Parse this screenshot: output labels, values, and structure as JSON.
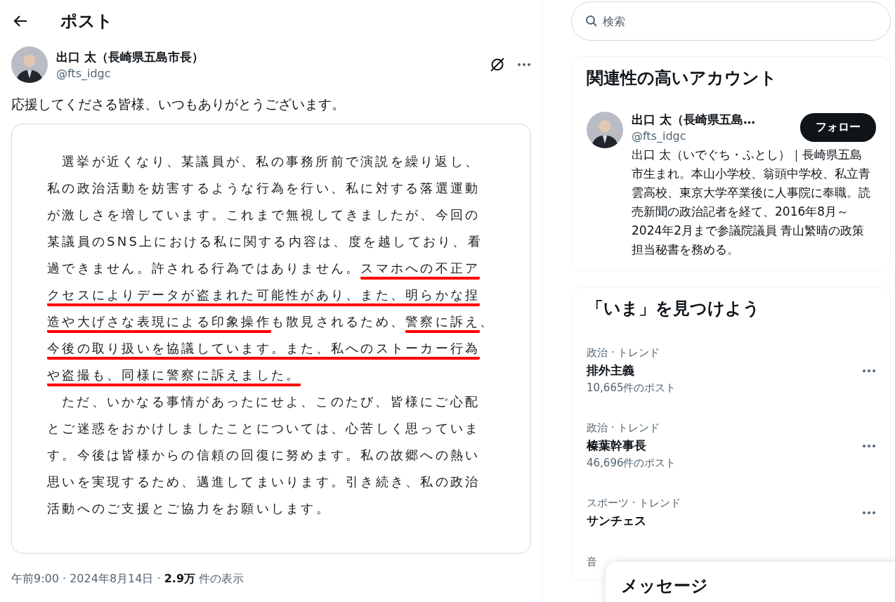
{
  "header": {
    "title": "ポスト"
  },
  "post": {
    "author": {
      "name": "出口 太（長崎県五島市長）",
      "handle": "@fts_idgc"
    },
    "text": "応援してくださる皆様、いつもありがとうございます。",
    "document": [
      {
        "indent": true,
        "segments": [
          {
            "text": "選挙が近くなり、某議員が、私の事務所前で演説を繰り返し、",
            "underlined": false
          }
        ]
      },
      {
        "indent": false,
        "segments": [
          {
            "text": "私の政治活動を妨害するような行為を行い、私に対する落選運動",
            "underlined": false
          }
        ]
      },
      {
        "indent": false,
        "segments": [
          {
            "text": "が激しさを増しています。これまで無視してきましたが、今回の",
            "underlined": false
          }
        ]
      },
      {
        "indent": false,
        "segments": [
          {
            "text": "某議員のSNS上における私に関する内容は、度を越しており、看",
            "underlined": false
          }
        ]
      },
      {
        "indent": false,
        "segments": [
          {
            "text": "過できません。許される行為ではありません。",
            "underlined": false
          },
          {
            "text": "スマホへの不正ア",
            "underlined": true
          }
        ]
      },
      {
        "indent": false,
        "segments": [
          {
            "text": "クセスによりデータが盗まれた可能性があり、また、明らかな捏",
            "underlined": true
          }
        ]
      },
      {
        "indent": false,
        "segments": [
          {
            "text": "造や大げさな表現による印象操作",
            "underlined": true
          },
          {
            "text": "も散見されるため、",
            "underlined": false
          },
          {
            "text": "警察に訴え",
            "underlined": true
          },
          {
            "text": "、",
            "underlined": false
          }
        ]
      },
      {
        "indent": false,
        "segments": [
          {
            "text": "今後の取り扱いを協議しています。また、私へのストーカー行為",
            "underlined": true
          }
        ]
      },
      {
        "indent": false,
        "segments": [
          {
            "text": "や盗撮も、同様に警察に訴えました。",
            "underlined": true
          }
        ]
      },
      {
        "indent": true,
        "segments": [
          {
            "text": "ただ、いかなる事情があったにせよ、このたび、皆様にご心配",
            "underlined": false
          }
        ]
      },
      {
        "indent": false,
        "segments": [
          {
            "text": "とご迷惑をおかけしましたことについては、心苦しく思っていま",
            "underlined": false
          }
        ]
      },
      {
        "indent": false,
        "segments": [
          {
            "text": "す。今後は皆様からの信頼の回復に努めます。私の故郷への熱い",
            "underlined": false
          }
        ]
      },
      {
        "indent": false,
        "segments": [
          {
            "text": "思いを実現するため、邁進してまいります。引き続き、私の政治",
            "underlined": false
          }
        ]
      },
      {
        "indent": false,
        "segments": [
          {
            "text": "活動へのご支援とご協力をお願いします。",
            "underlined": false
          }
        ]
      }
    ],
    "meta": "午前9:00 · 2024年8月14日 · **2.9万** 件の表示"
  },
  "search": {
    "placeholder": "検索"
  },
  "related": {
    "title": "関連性の高いアカウント",
    "account": {
      "name": "出口 太（長崎県五島…",
      "handle": "@fts_idgc",
      "button": "フォロー",
      "bio": "出口 太（いでぐち・ふとし）｜長崎県五島市生まれ。本山小学校、翁頭中学校、私立青雲高校、東京大学卒業後に人事院に奉職。読売新聞の政治記者を経て、2016年8月～2024年2月まで参議院議員 青山繁晴の政策担当秘書を務める。"
    }
  },
  "trends": {
    "title": "「いま」を見つけよう",
    "items": [
      {
        "category": "政治 · トレンド",
        "topic": "排外主義",
        "count": "10,665件のポスト"
      },
      {
        "category": "政治 · トレンド",
        "topic": "榛葉幹事長",
        "count": "46,696件のポスト"
      },
      {
        "category": "スポーツ · トレンド",
        "topic": "サンチェス"
      },
      {
        "category": "音"
      }
    ]
  },
  "messages": {
    "title": "メッセージ"
  }
}
